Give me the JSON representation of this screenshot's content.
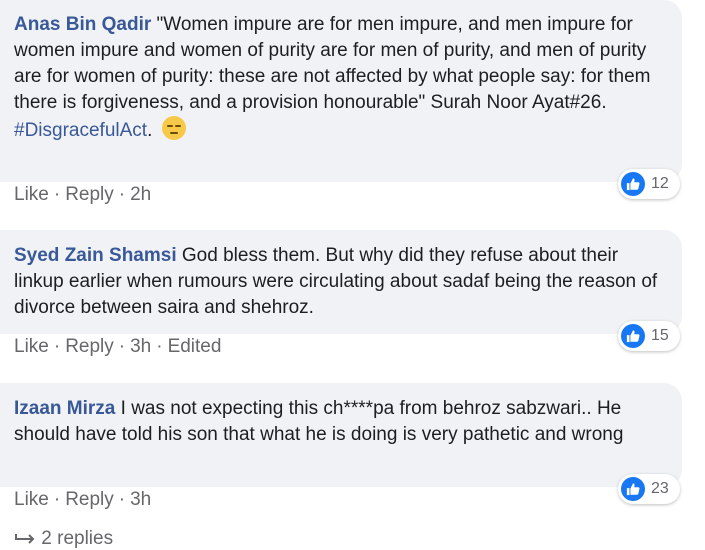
{
  "colors": {
    "author": "#385898",
    "bubble": "#f0f2f5",
    "meta": "#65676b",
    "like": "#1877f2"
  },
  "comments": [
    {
      "author": "Anas Bin Qadir",
      "text": " \"Women impure are for men impure, and men impure for women impure and women of purity are for men of purity, and men of purity are for women of purity: these are not affected by what people say: for them there is forgiveness, and a provision honourable\" Surah Noor Ayat#26.",
      "hashtag": "#DisgracefulAct",
      "after_hashtag": ".",
      "emoji": "expressionless-face-icon",
      "like_label": "Like",
      "reply_label": "Reply",
      "time": "2h",
      "reactions": "12"
    },
    {
      "author": "Syed Zain Shamsi",
      "text": " God bless them. But why did they refuse about their linkup earlier when rumours were circulating about sadaf being the reason of divorce between saira and shehroz.",
      "like_label": "Like",
      "reply_label": "Reply",
      "time": "3h",
      "edited": "Edited",
      "reactions": "15"
    },
    {
      "author": "Izaan Mirza",
      "text": " I was not expecting this ch****pa from behroz sabzwari.. He should have told his son that what he is doing is very pathetic and wrong",
      "like_label": "Like",
      "reply_label": "Reply",
      "time": "3h",
      "reactions": "23"
    }
  ],
  "replies_link": "2 replies"
}
